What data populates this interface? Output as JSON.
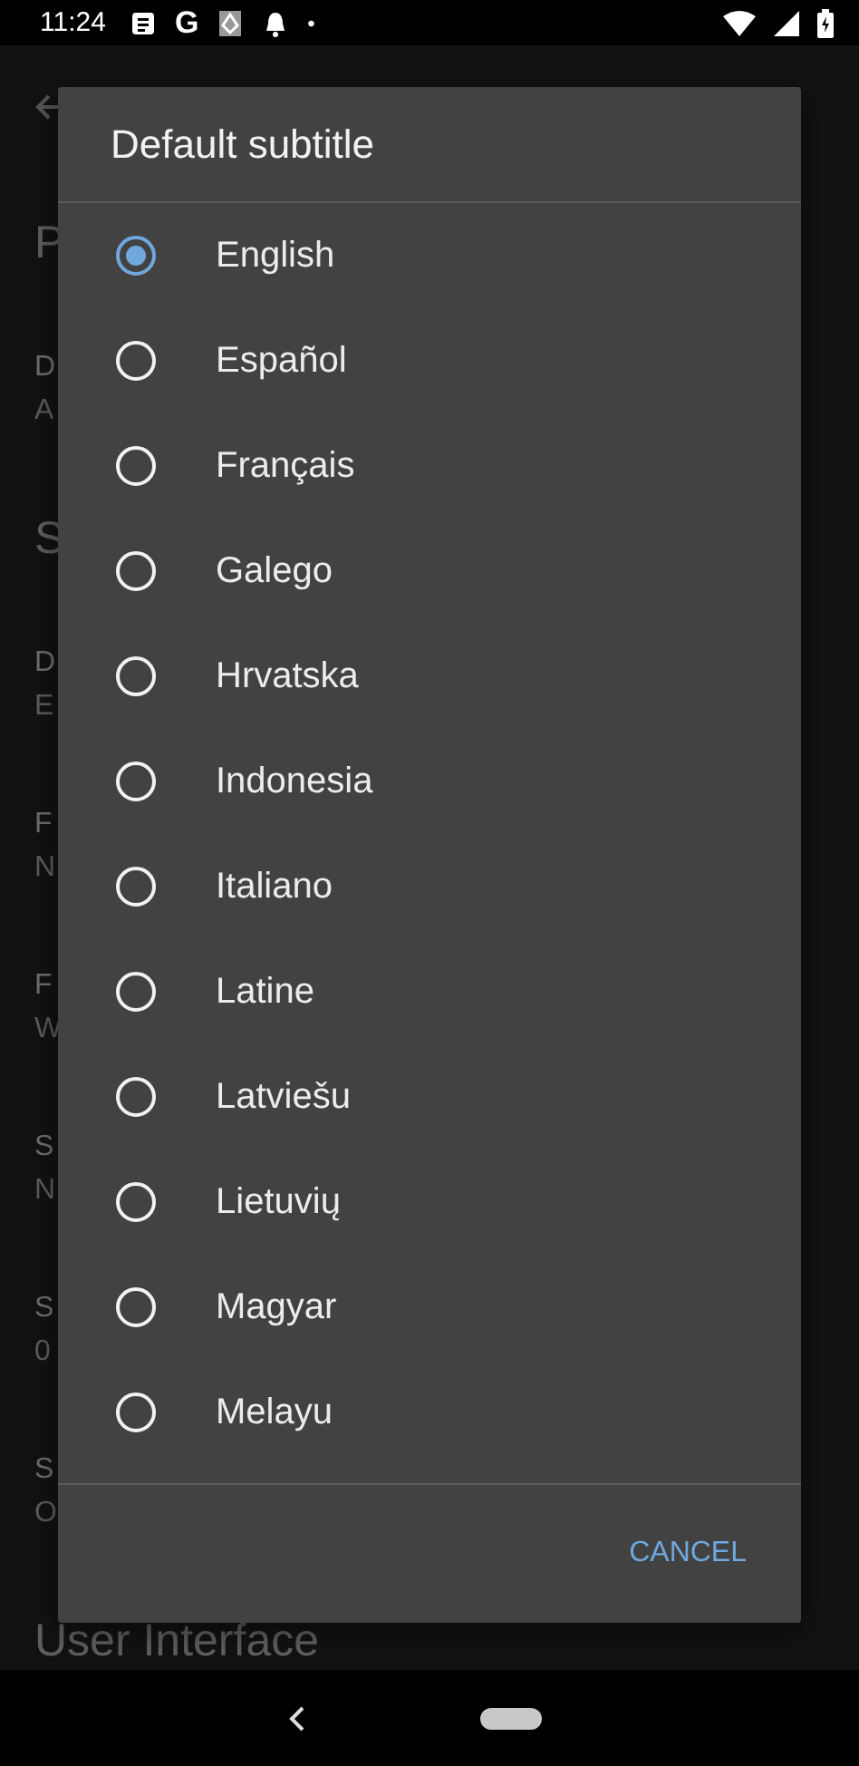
{
  "status_bar": {
    "time": "11:24",
    "app_letter": "G",
    "more": "•"
  },
  "page": {
    "sections": [
      {
        "header": "P",
        "items": [
          {
            "title": "D",
            "summary": "A"
          }
        ]
      },
      {
        "header": "S",
        "items": [
          {
            "title": "D",
            "summary": "E"
          },
          {
            "title": "F",
            "summary": "N"
          },
          {
            "title": "F",
            "summary": "W"
          },
          {
            "title": "S",
            "summary": "N"
          },
          {
            "title": "S",
            "summary": "0"
          },
          {
            "title": "S",
            "summary": "O"
          }
        ]
      },
      {
        "header": "User Interface"
      }
    ]
  },
  "dialog": {
    "title": "Default subtitle",
    "options": [
      {
        "label": "English",
        "selected": true
      },
      {
        "label": "Español",
        "selected": false
      },
      {
        "label": "Français",
        "selected": false
      },
      {
        "label": "Galego",
        "selected": false
      },
      {
        "label": "Hrvatska",
        "selected": false
      },
      {
        "label": "Indonesia",
        "selected": false
      },
      {
        "label": "Italiano",
        "selected": false
      },
      {
        "label": "Latine",
        "selected": false
      },
      {
        "label": "Latviešu",
        "selected": false
      },
      {
        "label": "Lietuvių",
        "selected": false
      },
      {
        "label": "Magyar",
        "selected": false
      },
      {
        "label": "Melayu",
        "selected": false
      }
    ],
    "cancel": "CANCEL"
  }
}
